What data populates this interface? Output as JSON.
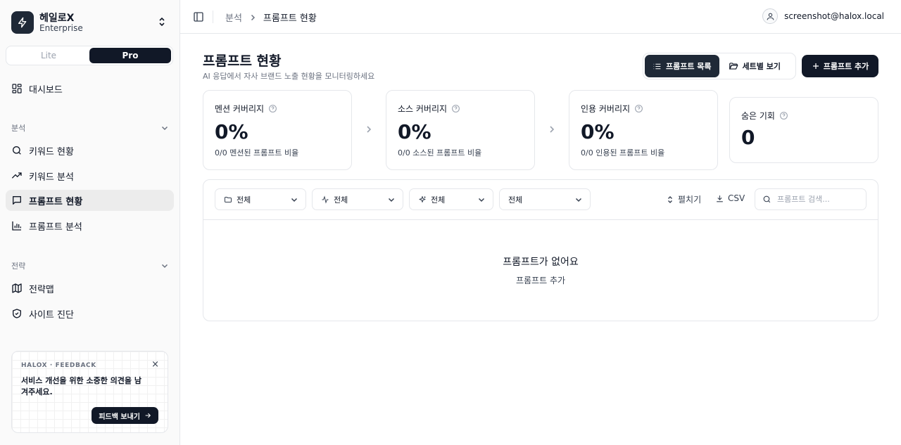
{
  "org": {
    "name": "헤일로X",
    "plan": "Enterprise"
  },
  "plan_toggle": {
    "lite": "Lite",
    "pro": "Pro",
    "selected": "Pro"
  },
  "sidebar": {
    "dashboard": "대시보드",
    "group_analysis": "분석",
    "analysis_items": [
      "키워드 현황",
      "키워드 분석",
      "프롬프트 현황",
      "프롬프트 분석"
    ],
    "active_item": "프롬프트 현황",
    "group_strategy": "전략",
    "strategy_items": [
      "전략맵",
      "사이트 진단"
    ]
  },
  "feedback": {
    "tag": "HALOX · FEEDBACK",
    "text": "서비스 개선을 위한 소중한 의견을 남겨주세요.",
    "button": "피드백 보내기",
    "close": "×"
  },
  "breadcrumb": {
    "parent": "분석",
    "current": "프롬프트 현황"
  },
  "user": {
    "email": "screenshot@halox.local"
  },
  "page": {
    "title": "프롬프트 현황",
    "subtitle": "AI 응답에서 자사 브랜드 노출 현황을 모니터링하세요"
  },
  "view_toggle": {
    "list": "프롬프트 목록",
    "set": "세트별 보기",
    "selected": "프롬프트 목록"
  },
  "add_button": "프롬프트 추가",
  "metrics": [
    {
      "title": "멘션 커버리지",
      "value": "0%",
      "sub": "0/0 멘션된 프롬프트 비율"
    },
    {
      "title": "소스 커버리지",
      "value": "0%",
      "sub": "0/0 소스된 프롬프트 비율"
    },
    {
      "title": "인용 커버리지",
      "value": "0%",
      "sub": "0/0 인용된 프롬프트 비율"
    },
    {
      "title": "숨은 기회",
      "value": "0"
    }
  ],
  "filters": [
    "전체",
    "전체",
    "전체",
    "전체"
  ],
  "actions": {
    "expand": "펼치기",
    "csv": "CSV"
  },
  "search": {
    "placeholder": "프롬프트 검색...",
    "value": ""
  },
  "empty": {
    "title": "프롬프트가 없어요",
    "action": "프롬프트 추가"
  },
  "colors": {
    "primary": "#111827",
    "border": "#e5e7eb",
    "sidebar_bg": "#fafafa",
    "muted": "#6b7280"
  }
}
